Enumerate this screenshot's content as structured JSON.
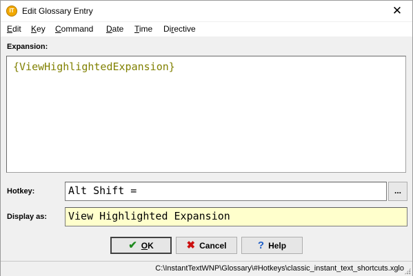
{
  "window": {
    "title": "Edit Glossary Entry",
    "app_icon_text": "IT",
    "close_glyph": "✕"
  },
  "menu": [
    {
      "prefix": "",
      "accel": "E",
      "rest": "dit"
    },
    {
      "prefix": "",
      "accel": "K",
      "rest": "ey"
    },
    {
      "prefix": "",
      "accel": "C",
      "rest": "ommand"
    },
    {
      "prefix": "",
      "accel": "D",
      "rest": "ate"
    },
    {
      "prefix": "",
      "accel": "T",
      "rest": "ime"
    },
    {
      "prefix": "Di",
      "accel": "r",
      "rest": "ective"
    }
  ],
  "expansion": {
    "label": "Expansion:",
    "value": "{ViewHighlightedExpansion}"
  },
  "hotkey": {
    "label": "Hotkey:",
    "value": "Alt Shift =",
    "browse_label": "..."
  },
  "display_as": {
    "label": "Display as:",
    "value": "View Highlighted Expansion"
  },
  "buttons": {
    "ok": {
      "label_accel": "O",
      "label_rest": "K",
      "icon": "check-icon"
    },
    "cancel": {
      "label": "Cancel",
      "icon": "x-icon"
    },
    "help": {
      "label": "Help",
      "icon": "question-icon"
    }
  },
  "status": {
    "path": "C:\\InstantTextWNP\\Glossary\\#Hotkeys\\classic_instant_text_shortcuts.xglo"
  },
  "colors": {
    "expansion_text": "#808000",
    "display_bg": "#ffffcc",
    "ok_icon": "#1f8a1f",
    "cancel_icon": "#cc1010",
    "help_icon": "#1e5ec8"
  }
}
